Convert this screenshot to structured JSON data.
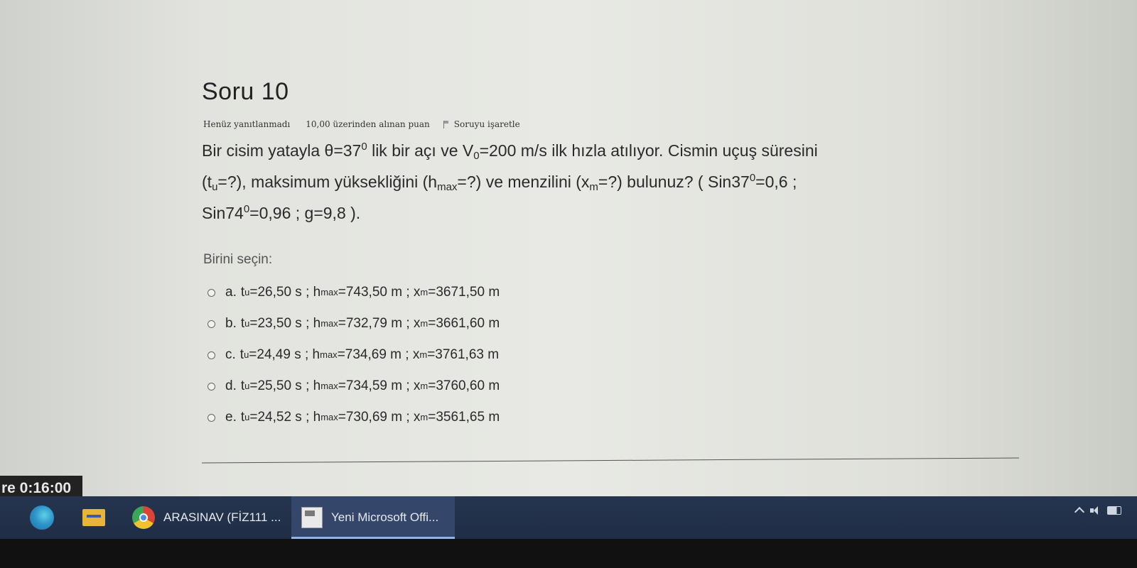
{
  "question": {
    "title": "Soru 10",
    "status": "Henüz yanıtlanmadı",
    "points": "10,00 üzerinden alınan puan",
    "flag_label": "Soruyu işaretle",
    "line1": {
      "a": "Bir cisim yatayla  θ=37",
      "sup1": "0",
      "b": " lik bir açı ve  V",
      "sub1": "0",
      "c": "=200 m/s ilk hızla atılıyor. Cismin uçuş süresini"
    },
    "line2": {
      "a": "(t",
      "sub1": "u",
      "b": "=?), maksimum yüksekliğini (h",
      "sub2": "max",
      "c": "=?) ve menzilini (x",
      "sub3": "m",
      "d": "=?) bulunuz? ( Sin37",
      "sup1": "0",
      "e": "=0,6 ;"
    },
    "line3": {
      "a": "Sin74",
      "sup1": "0",
      "b": "=0,96   ;   g=9,8 )."
    }
  },
  "choose_label": "Birini seçin:",
  "answers": [
    {
      "letter": "a.",
      "t": "=26,50 s  ;  h",
      "h": "=743,50 m  ;  x",
      "x": "=3671,50 m"
    },
    {
      "letter": "b.",
      "t": "=23,50 s  ;  h",
      "h": "=732,79 m  ;  x",
      "x": "=3661,60 m"
    },
    {
      "letter": "c.",
      "t": "=24,49 s  ;  h",
      "h": "=734,69 m  ;   x",
      "x": "=3761,63 m"
    },
    {
      "letter": "d.",
      "t": "=25,50 s  ;  h",
      "h": "=734,59 m  ; x",
      "x": "=3760,60 m"
    },
    {
      "letter": "e.",
      "t": "=24,52 s  ;  h",
      "h": "=730,69 m  ; x",
      "x": "=3561,65 m"
    }
  ],
  "sub": {
    "t": "u",
    "h": "max",
    "x": "m"
  },
  "timer": "re 0:16:00",
  "taskbar": {
    "chrome_label": "ARASINAV (FİZ111 ...",
    "word_label": "Yeni Microsoft Offi..."
  }
}
